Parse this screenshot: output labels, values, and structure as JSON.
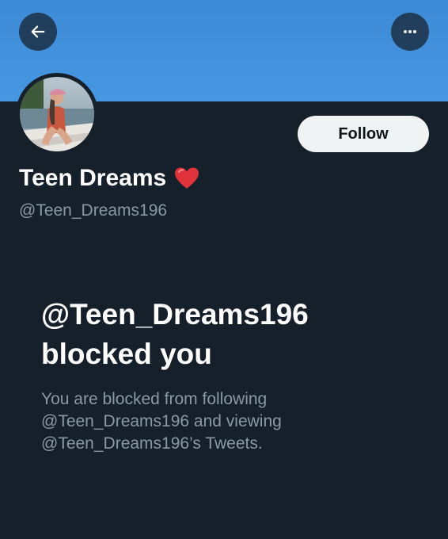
{
  "profile": {
    "display_name": "Teen Dreams",
    "handle": "@Teen_Dreams196",
    "follow_label": "Follow",
    "badge_icon": "red-heart-emoji"
  },
  "header": {
    "back_icon": "arrow-left-icon",
    "more_icon": "more-horizontal-icon"
  },
  "blocked": {
    "title_line1": "@Teen_Dreams196",
    "title_line2": "blocked you",
    "desc_line1": "You are blocked from following",
    "desc_line2": "@Teen_Dreams196 and viewing",
    "desc_line3": "@Teen_Dreams196’s Tweets."
  },
  "colors": {
    "banner": "#4796e2",
    "background": "#15202b",
    "secondary_text": "#8b98a5",
    "follow_button_bg": "#eff3f4",
    "heart": "#e0333c"
  }
}
